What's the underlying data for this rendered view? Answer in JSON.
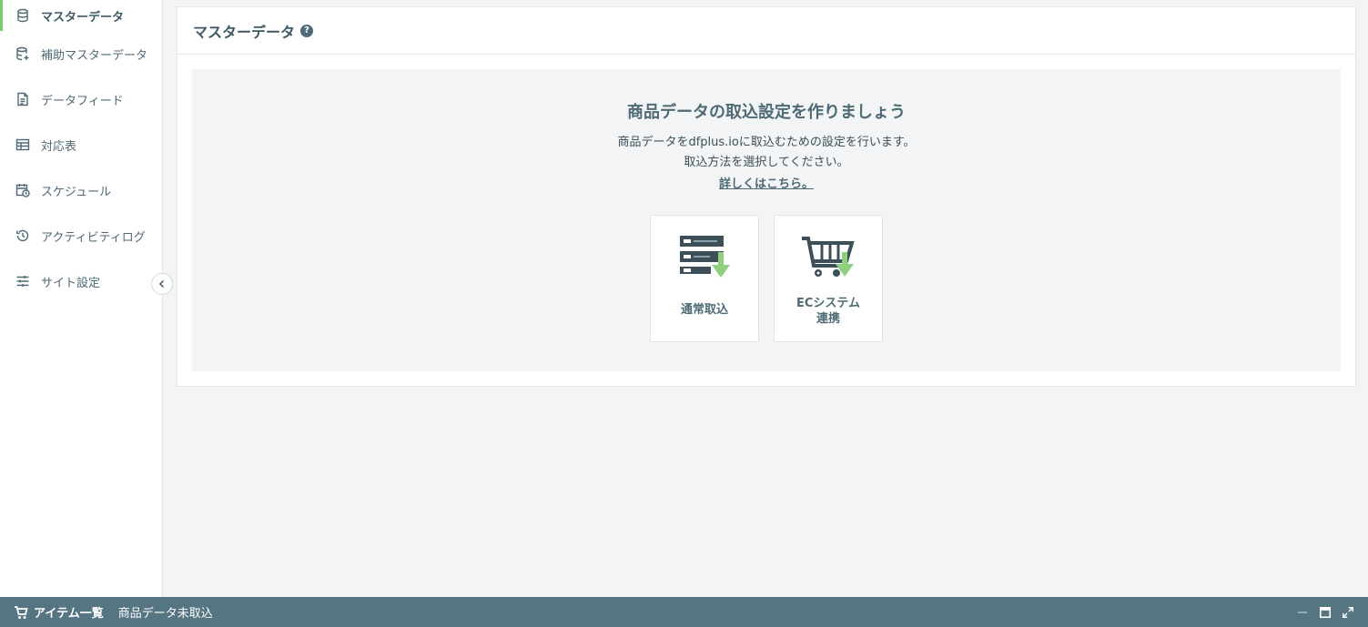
{
  "sidebar": {
    "items": [
      {
        "label": "マスターデータ",
        "icon": "database-icon"
      },
      {
        "label": "補助マスターデータ",
        "icon": "database-add-icon"
      },
      {
        "label": "データフィード",
        "icon": "document-icon"
      },
      {
        "label": "対応表",
        "icon": "table-icon"
      },
      {
        "label": "スケジュール",
        "icon": "calendar-clock-icon"
      },
      {
        "label": "アクティビティログ",
        "icon": "history-icon"
      },
      {
        "label": "サイト設定",
        "icon": "sliders-icon"
      }
    ],
    "collapse_icon": "chevron-left-icon"
  },
  "main": {
    "title": "マスターデータ",
    "help_glyph": "?",
    "empty": {
      "heading": "商品データの取込設定を作りましょう",
      "desc_line1": "商品データをdfplus.ioに取込むための設定を行います。",
      "desc_line2": "取込方法を選択してください。",
      "link": "詳しくはこちら。",
      "cards": [
        {
          "label": "通常取込",
          "icon": "server-download-icon"
        },
        {
          "label_line1": "ECシステム",
          "label_line2": "連携",
          "icon": "cart-download-icon"
        }
      ]
    }
  },
  "bottom_bar": {
    "title": "アイテム一覧",
    "status": "商品データ未取込",
    "icons": [
      "cart-icon",
      "minimize-icon",
      "maximize-icon",
      "expand-icon"
    ]
  },
  "colors": {
    "accent_green": "#7ccb6c",
    "bar_bg": "#547581",
    "text_primary": "#4e6a75"
  }
}
